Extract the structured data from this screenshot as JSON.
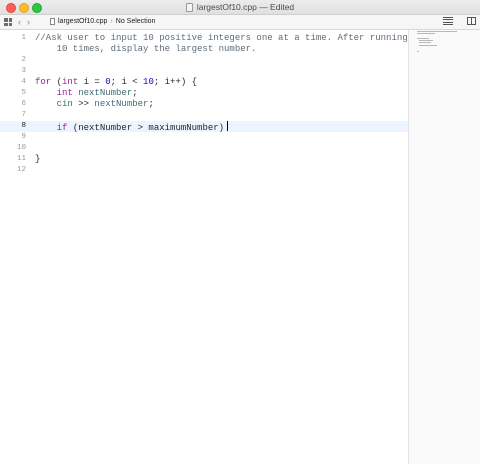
{
  "window": {
    "title": "largestOf10.cpp — Edited"
  },
  "jumpbar": {
    "filename": "largestOf10.cpp",
    "selection": "No Selection"
  },
  "editor": {
    "lines": [
      {
        "n": "1",
        "current": false,
        "tokens": [
          {
            "t": "comment",
            "s": "//Ask user to input 10 positive integers one at a time. After running"
          }
        ]
      },
      {
        "n": "",
        "current": false,
        "tokens": [
          {
            "t": "comment",
            "s": "    10 times, display the largest number."
          }
        ]
      },
      {
        "n": "2",
        "current": false,
        "tokens": []
      },
      {
        "n": "3",
        "current": false,
        "tokens": []
      },
      {
        "n": "4",
        "current": false,
        "tokens": [
          {
            "t": "kw",
            "s": "for"
          },
          {
            "t": "plain",
            "s": " ("
          },
          {
            "t": "kw",
            "s": "int"
          },
          {
            "t": "plain",
            "s": " i = "
          },
          {
            "t": "num",
            "s": "0"
          },
          {
            "t": "plain",
            "s": "; i < "
          },
          {
            "t": "num",
            "s": "10"
          },
          {
            "t": "plain",
            "s": "; i++) {"
          }
        ]
      },
      {
        "n": "5",
        "current": false,
        "tokens": [
          {
            "t": "plain",
            "s": "    "
          },
          {
            "t": "kw",
            "s": "int"
          },
          {
            "t": "plain",
            "s": " "
          },
          {
            "t": "var",
            "s": "nextNumber"
          },
          {
            "t": "plain",
            "s": ";"
          }
        ]
      },
      {
        "n": "6",
        "current": false,
        "tokens": [
          {
            "t": "plain",
            "s": "    "
          },
          {
            "t": "var",
            "s": "cin"
          },
          {
            "t": "plain",
            "s": " >> "
          },
          {
            "t": "var",
            "s": "nextNumber"
          },
          {
            "t": "plain",
            "s": ";"
          }
        ]
      },
      {
        "n": "7",
        "current": false,
        "tokens": []
      },
      {
        "n": "8",
        "current": true,
        "caret": true,
        "tokens": [
          {
            "t": "plain",
            "s": "    "
          },
          {
            "t": "kw",
            "s": "if"
          },
          {
            "t": "plain",
            "s": " (nextNumber > maximumNumber)"
          }
        ]
      },
      {
        "n": "9",
        "current": false,
        "tokens": []
      },
      {
        "n": "10",
        "current": false,
        "tokens": []
      },
      {
        "n": "11",
        "current": false,
        "tokens": [
          {
            "t": "plain",
            "s": "}"
          }
        ]
      },
      {
        "n": "12",
        "current": false,
        "tokens": []
      }
    ]
  }
}
